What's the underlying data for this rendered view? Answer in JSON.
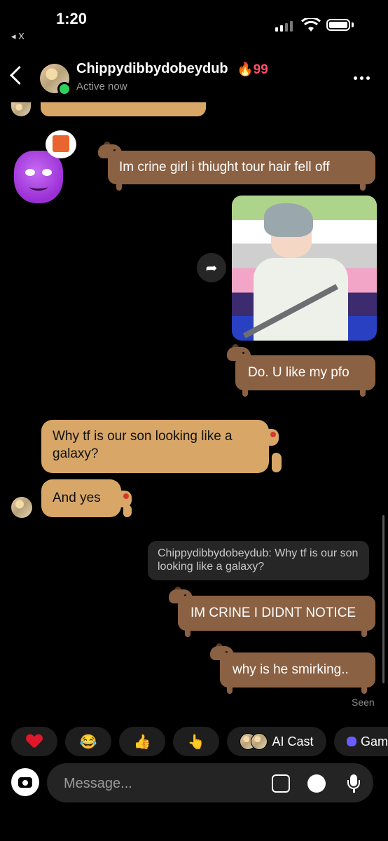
{
  "status_bar": {
    "time": "1:20",
    "back_app": "◂ X"
  },
  "header": {
    "contact_name": "Chippydibbydobeydub",
    "streak": "🔥99",
    "status": "Active now"
  },
  "messages": [
    {
      "side": "right",
      "style": "dachshund",
      "text": "Im crine girl i thiught tour hair fell off"
    },
    {
      "side": "right",
      "style": "image",
      "text": ""
    },
    {
      "side": "right",
      "style": "dachshund",
      "text": "Do. U like my pfo"
    },
    {
      "side": "left",
      "style": "capybara",
      "text": "Why tf is our son looking like a galaxy?"
    },
    {
      "side": "left",
      "style": "capybara",
      "text": "And yes"
    },
    {
      "side": "right",
      "style": "reply",
      "text": "Chippydibbydobeydub: Why tf is our son looking like a galaxy?"
    },
    {
      "side": "right",
      "style": "dachshund",
      "text": "IM CRINE I DIDNT NOTICE"
    },
    {
      "side": "right",
      "style": "dachshund",
      "text": "why is he smirking.."
    }
  ],
  "seen_label": "Seen",
  "quick_reactions": [
    {
      "emoji": "heart-icon",
      "label": "❤️"
    },
    {
      "emoji": "😂",
      "label": "😂"
    },
    {
      "emoji": "👍",
      "label": "👍"
    },
    {
      "emoji": "👆",
      "label": "👆"
    },
    {
      "emoji": "ai-cast",
      "label": "AI Cast"
    },
    {
      "emoji": "game-controller-icon",
      "label": "Gam"
    }
  ],
  "composer": {
    "placeholder": "Message..."
  },
  "colors": {
    "dachshund_bubble": "#8b6143",
    "capybara_bubble": "#d8a767",
    "streak": "#ff4f6a",
    "online": "#2fd15b"
  }
}
